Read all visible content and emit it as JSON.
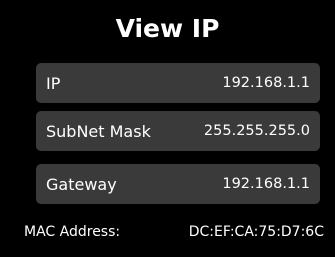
{
  "header": {
    "title": "View IP"
  },
  "network": {
    "ip": {
      "label": "IP",
      "value": "192.168.1.1"
    },
    "subnet_mask": {
      "label": "SubNet Mask",
      "value": "255.255.255.0"
    },
    "gateway": {
      "label": "Gateway",
      "value": "192.168.1.1"
    }
  },
  "footer": {
    "mac_label": "MAC Address:",
    "mac_value": "DC:EF:CA:75:D7:6C"
  },
  "colors": {
    "background": "#000000",
    "row_background": "#3a3a3a",
    "text": "#ffffff"
  }
}
